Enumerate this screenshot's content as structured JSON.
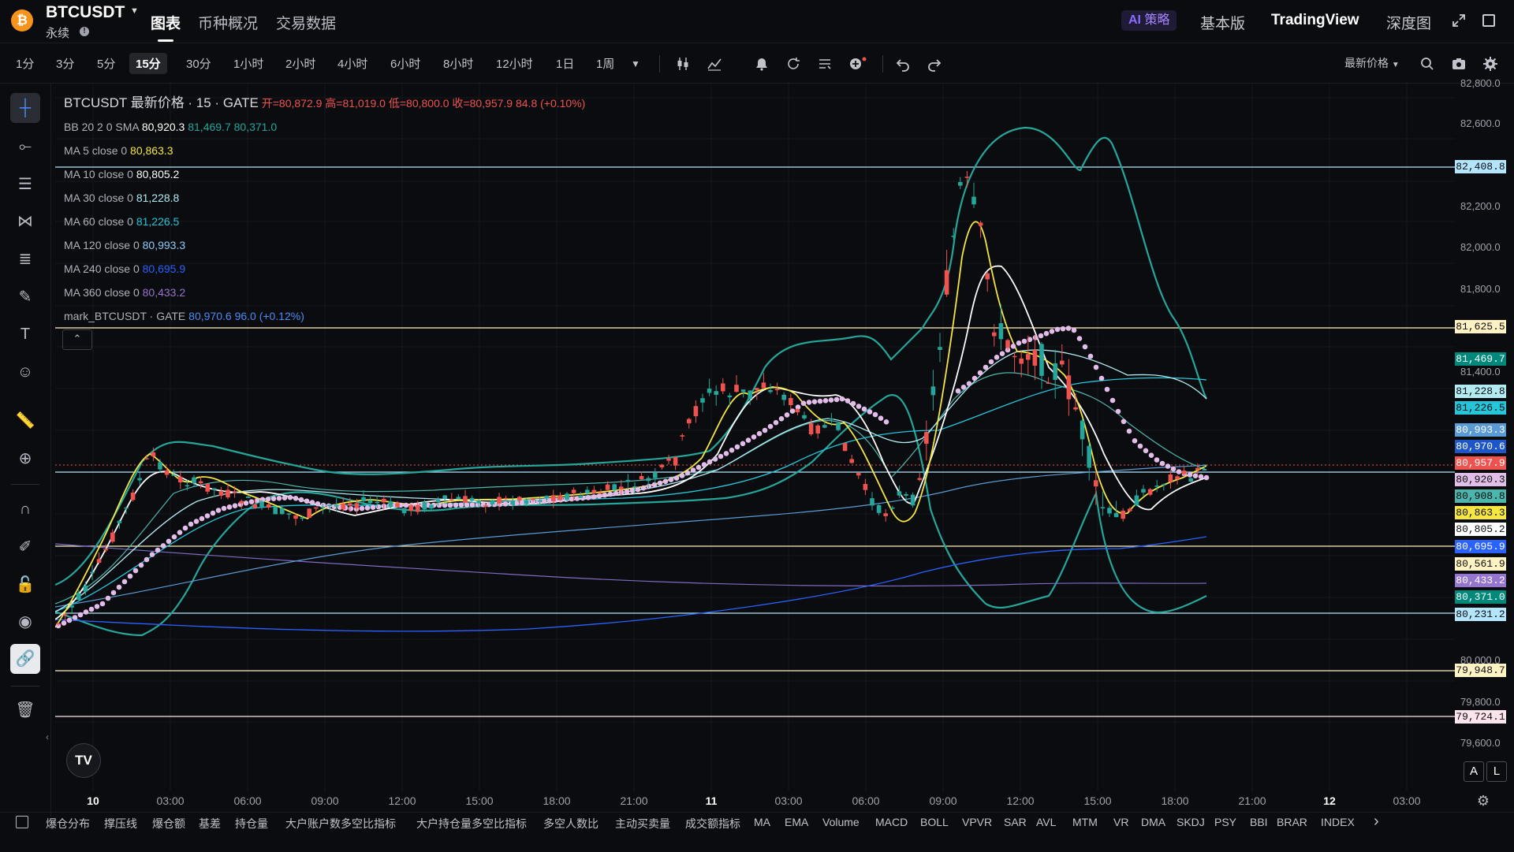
{
  "header": {
    "coin_logo": "₿",
    "symbol": "BTCUSDT",
    "contract_type": "永续",
    "tabs": [
      "图表",
      "币种概况",
      "交易数据"
    ],
    "ai_badge": {
      "ai": "AI",
      "label": "策略"
    },
    "views": [
      "基本版",
      "TradingView",
      "深度图"
    ]
  },
  "toolbar": {
    "intervals": [
      "1分",
      "3分",
      "5分",
      "15分",
      "30分",
      "1小时",
      "2小时",
      "4小时",
      "6小时",
      "8小时",
      "12小时",
      "1日",
      "1周"
    ],
    "active_interval": "15分",
    "price_type": "最新价格"
  },
  "legend": {
    "title": "BTCUSDT 最新价格 · 15 · GATE",
    "ohlc": {
      "open": "开=80,872.9",
      "high": "高=81,019.0",
      "low": "低=80,800.0",
      "close": "收=80,957.9",
      "change": "84.8 (+0.10%)"
    },
    "bb": {
      "label": "BB 20 2 0 SMA",
      "v1": "80,920.3",
      "v2": "81,469.7",
      "v3": "80,371.0"
    },
    "ma": [
      {
        "label": "MA 5 close 0",
        "value": "80,863.3",
        "color": "#f5e642"
      },
      {
        "label": "MA 10 close 0",
        "value": "80,805.2",
        "color": "#ffffff"
      },
      {
        "label": "MA 30 close 0",
        "value": "81,228.8",
        "color": "#b2ebf2"
      },
      {
        "label": "MA 60 close 0",
        "value": "81,226.5",
        "color": "#26c6da"
      },
      {
        "label": "MA 120 close 0",
        "value": "80,993.3",
        "color": "#90caf9"
      },
      {
        "label": "MA 240 close 0",
        "value": "80,695.9",
        "color": "#2962ff"
      },
      {
        "label": "MA 360 close 0",
        "value": "80,433.2",
        "color": "#9575cd"
      }
    ],
    "mark": {
      "label": "mark_BTCUSDT · GATE",
      "value": "80,970.6",
      "change": "96.0 (+0.12%)"
    }
  },
  "price_axis": {
    "ticks": [
      "82,800.0",
      "82,600.0",
      "82,200.0",
      "82,000.0",
      "81,800.0",
      "81,400.0",
      "80,000.0",
      "79,800.0",
      "79,600.0"
    ],
    "labels": [
      {
        "text": "82,408.8",
        "bg": "#b3e5fc",
        "fg": "#0b0c0f"
      },
      {
        "text": "81,625.5",
        "bg": "#fff3c4",
        "fg": "#0b0c0f"
      },
      {
        "text": "81,469.7",
        "bg": "#00897b",
        "fg": "#ffffff"
      },
      {
        "text": "81,228.8",
        "bg": "#b2ebf2",
        "fg": "#0b0c0f"
      },
      {
        "text": "81,226.5",
        "bg": "#26c6da",
        "fg": "#0b0c0f"
      },
      {
        "text": "80,993.3",
        "bg": "#5b9bd5",
        "fg": "#ffffff"
      },
      {
        "text": "80,970.6",
        "bg": "#1e56c8",
        "fg": "#ffffff"
      },
      {
        "text": "80,957.9",
        "bg": "#ef5350",
        "fg": "#ffffff"
      },
      {
        "text": "80,920.3",
        "bg": "#e1bee7",
        "fg": "#0b0c0f"
      },
      {
        "text": "80,908.8",
        "bg": "#4db6ac",
        "fg": "#0b0c0f"
      },
      {
        "text": "80,863.3",
        "bg": "#f5e642",
        "fg": "#0b0c0f"
      },
      {
        "text": "80,805.2",
        "bg": "#ffffff",
        "fg": "#0b0c0f"
      },
      {
        "text": "80,695.9",
        "bg": "#2962ff",
        "fg": "#ffffff"
      },
      {
        "text": "80,561.9",
        "bg": "#fff3c4",
        "fg": "#0b0c0f"
      },
      {
        "text": "80,433.2",
        "bg": "#9575cd",
        "fg": "#ffffff"
      },
      {
        "text": "80,371.0",
        "bg": "#00897b",
        "fg": "#ffffff"
      },
      {
        "text": "80,231.2",
        "bg": "#b3e5fc",
        "fg": "#0b0c0f"
      },
      {
        "text": "79,948.7",
        "bg": "#fff3c4",
        "fg": "#0b0c0f"
      },
      {
        "text": "79,724.1",
        "bg": "#fce4ec",
        "fg": "#0b0c0f"
      }
    ]
  },
  "time_axis": [
    {
      "label": "10",
      "bold": true
    },
    {
      "label": "03:00"
    },
    {
      "label": "06:00"
    },
    {
      "label": "09:00"
    },
    {
      "label": "12:00"
    },
    {
      "label": "15:00"
    },
    {
      "label": "18:00"
    },
    {
      "label": "21:00"
    },
    {
      "label": "11",
      "bold": true
    },
    {
      "label": "03:00"
    },
    {
      "label": "06:00"
    },
    {
      "label": "09:00"
    },
    {
      "label": "12:00"
    },
    {
      "label": "15:00"
    },
    {
      "label": "18:00"
    },
    {
      "label": "21:00"
    },
    {
      "label": "12",
      "bold": true
    },
    {
      "label": "03:00"
    }
  ],
  "chart_controls": {
    "auto": "A",
    "log": "L",
    "logo": "TV"
  },
  "bottom_indicators": [
    "爆仓分布",
    "撑压线",
    "爆仓额",
    "基差",
    "持仓量",
    "大户账户数多空比指标",
    "大户持仓量多空比指标",
    "多空人数比",
    "主动买卖量",
    "成交额指标",
    "MA",
    "EMA",
    "Volume",
    "MACD",
    "BOLL",
    "VPVR",
    "SAR",
    "AVL",
    "MTM",
    "VR",
    "DMA",
    "SKDJ",
    "PSY",
    "BBI",
    "BRAR",
    "INDEX"
  ]
}
